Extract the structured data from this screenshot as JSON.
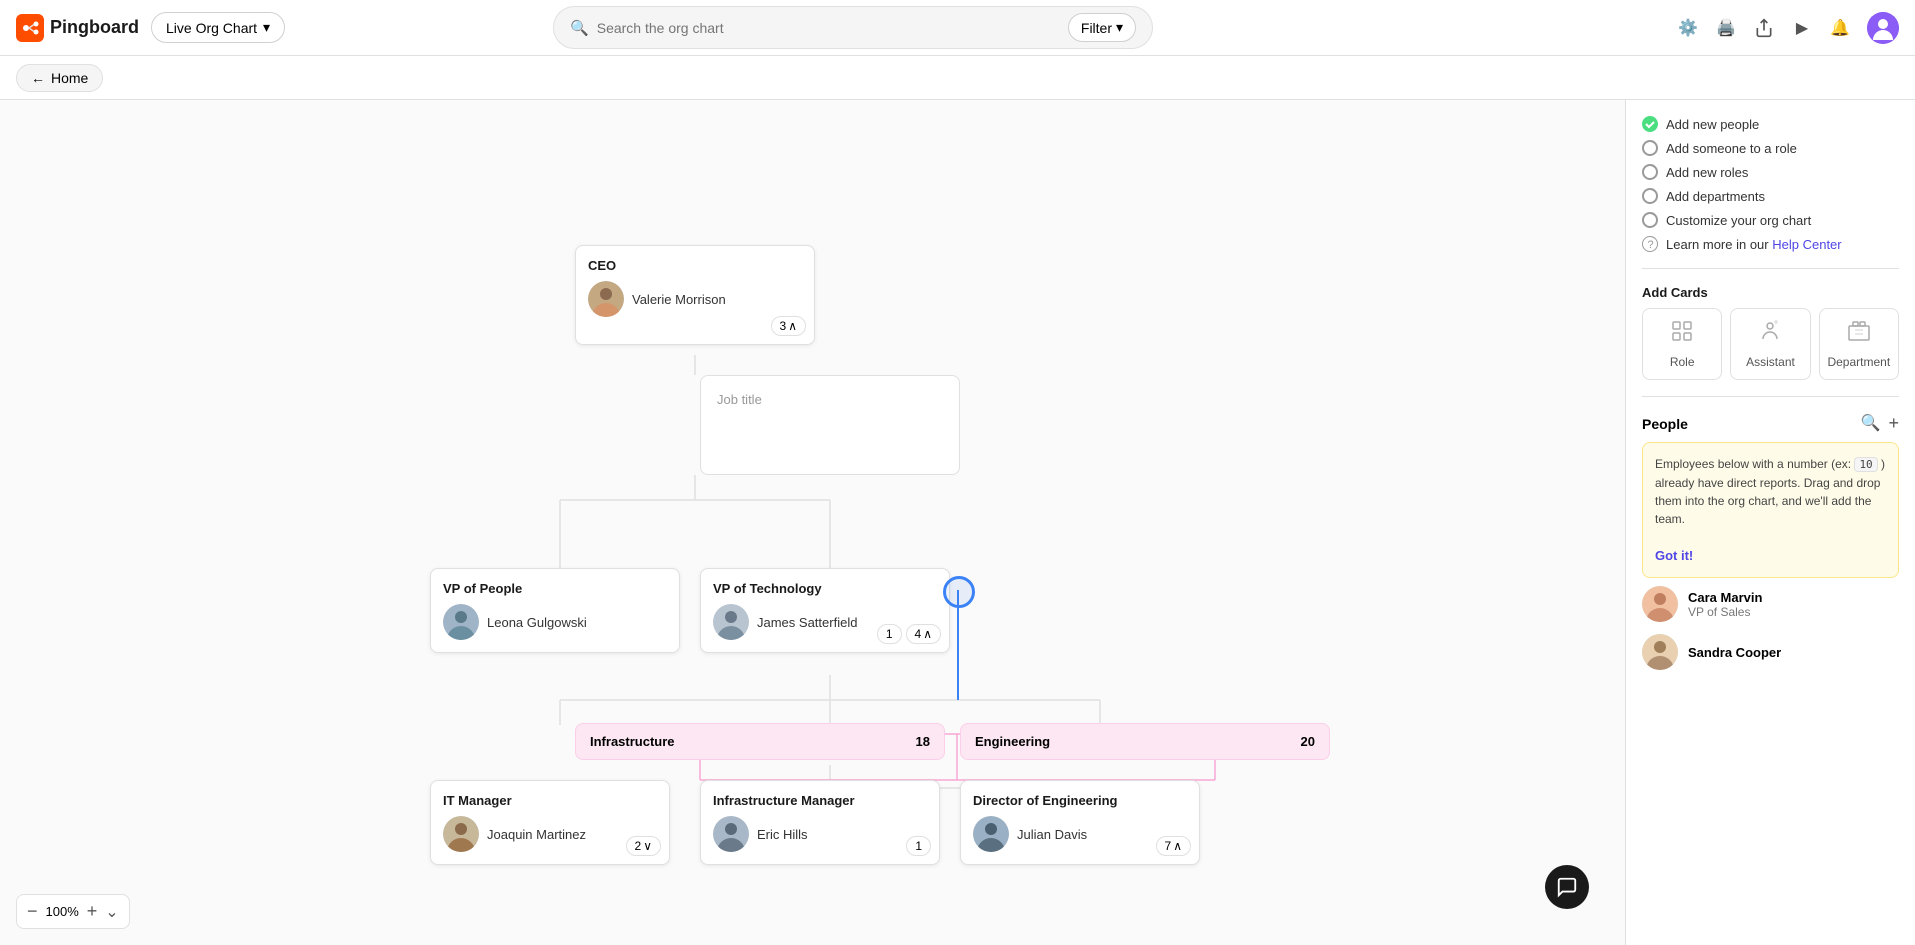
{
  "app": {
    "name": "Pingboard",
    "chart_selector": "Live Org Chart",
    "search_placeholder": "Search the org chart",
    "filter_label": "Filter",
    "home_label": "Home"
  },
  "header_icons": {
    "settings": "⚙",
    "print": "🖨",
    "share": "↗",
    "play": "▶",
    "notifications": "🔔"
  },
  "zoom": {
    "minus": "−",
    "percent": "100%",
    "plus": "+",
    "more": "⌄"
  },
  "org_nodes": {
    "ceo": {
      "title": "CEO",
      "person": "Valerie Morrison",
      "expand": "3"
    },
    "job_title": {
      "placeholder": "Job title"
    },
    "vp_people": {
      "title": "VP of People",
      "person": "Leona Gulgowski"
    },
    "vp_tech": {
      "title": "VP of Technology",
      "person": "James Satterfield",
      "expand1": "1",
      "expand2": "4"
    },
    "infra": {
      "dept": "Infrastructure",
      "count": "18"
    },
    "eng": {
      "dept": "Engineering",
      "count": "20"
    },
    "it_manager": {
      "title": "IT Manager",
      "person": "Joaquin Martinez",
      "expand": "2"
    },
    "infra_manager": {
      "title": "Infrastructure Manager",
      "person": "Eric Hills",
      "expand1": "1"
    },
    "dir_eng": {
      "title": "Director of Engineering",
      "person": "Julian Davis",
      "expand": "7"
    }
  },
  "sidebar": {
    "actions": [
      {
        "type": "check",
        "label": "Add new people"
      },
      {
        "type": "radio",
        "label": "Add someone to a role"
      },
      {
        "type": "radio",
        "label": "Add new roles"
      },
      {
        "type": "radio",
        "label": "Add departments"
      },
      {
        "type": "radio",
        "label": "Customize your org chart"
      },
      {
        "type": "help",
        "label": "Learn more in our",
        "link": "Help Center"
      }
    ],
    "add_cards_title": "Add Cards",
    "card_types": [
      "Role",
      "Assistant",
      "Department"
    ],
    "people_title": "People",
    "people_notice": "Employees below with a number (ex: 10 ) already have direct reports. Drag and drop them into the org chart, and we'll add the team.",
    "got_it": "Got it!",
    "people_list": [
      {
        "name": "Cara Marvin",
        "title": "VP of Sales"
      },
      {
        "name": "Sandra Cooper",
        "title": ""
      }
    ]
  }
}
